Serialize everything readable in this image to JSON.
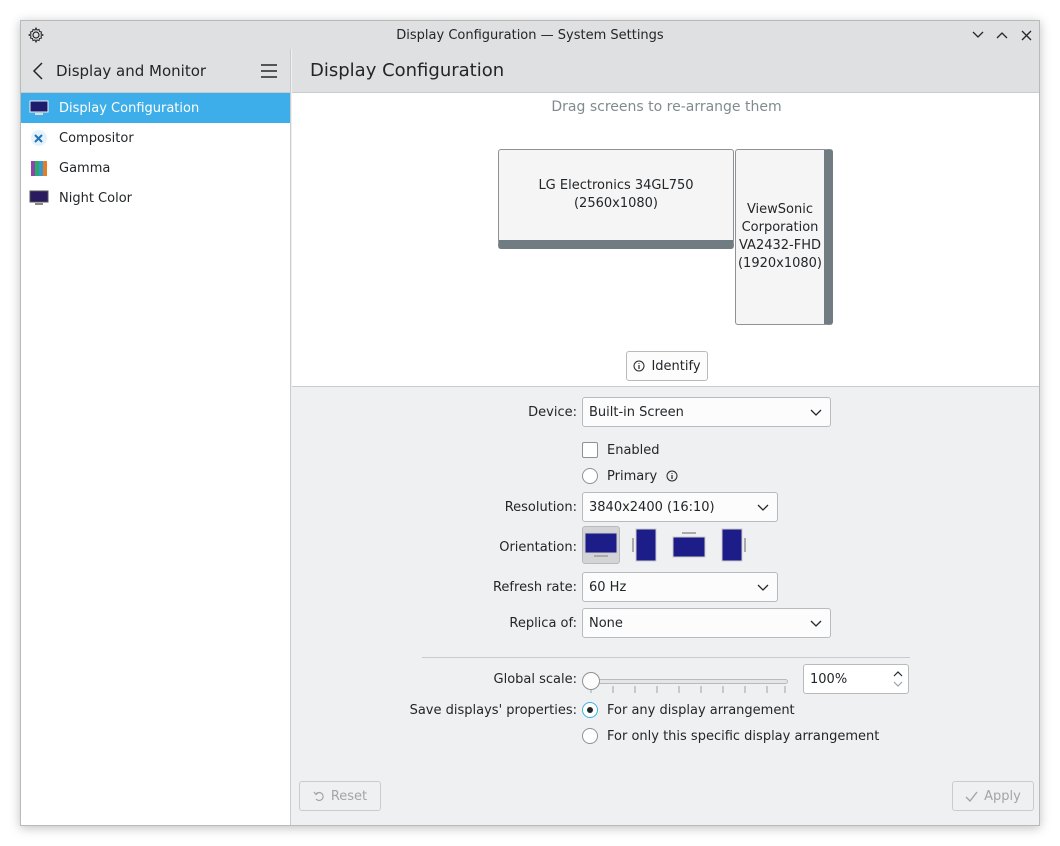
{
  "window": {
    "title": "Display Configuration — System Settings"
  },
  "sidebar": {
    "title": "Display and Monitor",
    "items": [
      {
        "label": "Display Configuration",
        "icon": "monitor-icon"
      },
      {
        "label": "Compositor",
        "icon": "tools-icon"
      },
      {
        "label": "Gamma",
        "icon": "gamma-icon"
      },
      {
        "label": "Night Color",
        "icon": "night-monitor-icon"
      }
    ]
  },
  "main": {
    "title": "Display Configuration",
    "arrange_hint": "Drag screens to re-arrange them",
    "screens": [
      {
        "name_line1": "LG Electronics 34GL750",
        "name_line2": "(2560x1080)"
      },
      {
        "name_line1": "ViewSonic",
        "name_line2": "Corporation",
        "name_line3": "VA2432-FHD",
        "name_line4": "(1920x1080)"
      }
    ],
    "identify_label": "Identify"
  },
  "form": {
    "device_label": "Device:",
    "device_value": "Built-in Screen",
    "enabled_label": "Enabled",
    "primary_label": "Primary",
    "resolution_label": "Resolution:",
    "resolution_value": "3840x2400 (16:10)",
    "orientation_label": "Orientation:",
    "refresh_label": "Refresh rate:",
    "refresh_value": "60 Hz",
    "replica_label": "Replica of:",
    "replica_value": "None",
    "scale_label": "Global scale:",
    "scale_value": "100%",
    "scale_level": 0,
    "save_label": "Save displays' properties:",
    "save_option_any": "For any display arrangement",
    "save_option_specific": "For only this specific display arrangement"
  },
  "footer": {
    "reset_label": "Reset",
    "apply_label": "Apply"
  },
  "colors": {
    "accent": "#3daee9",
    "panel": "#eff0f1",
    "header": "#dee0e2"
  }
}
